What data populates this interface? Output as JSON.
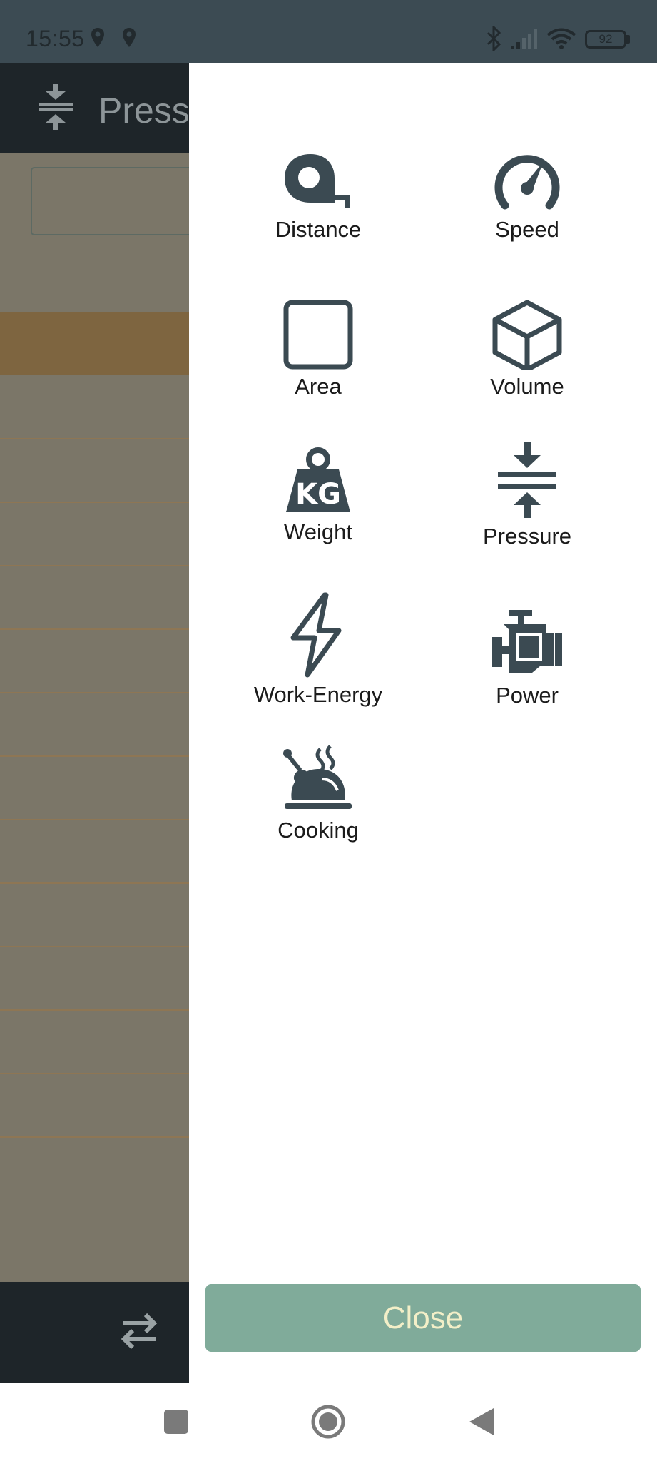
{
  "status_bar": {
    "time": "15:55",
    "battery": "92"
  },
  "background_app": {
    "title": "Press"
  },
  "drawer": {
    "categories": [
      {
        "label": "Distance",
        "icon": "tape-measure-icon"
      },
      {
        "label": "Speed",
        "icon": "speedometer-icon"
      },
      {
        "label": "Area",
        "icon": "square-icon"
      },
      {
        "label": "Volume",
        "icon": "cube-icon"
      },
      {
        "label": "Weight",
        "icon": "kg-weight-icon"
      },
      {
        "label": "Pressure",
        "icon": "compress-icon"
      },
      {
        "label": "Work-Energy",
        "icon": "lightning-bolt-icon"
      },
      {
        "label": "Power",
        "icon": "engine-icon"
      },
      {
        "label": "Cooking",
        "icon": "roast-turkey-icon"
      }
    ],
    "close_label": "Close"
  },
  "colors": {
    "icon": "#3b4a52",
    "close_button": "#80ab9a",
    "close_text": "#f3efc8"
  }
}
